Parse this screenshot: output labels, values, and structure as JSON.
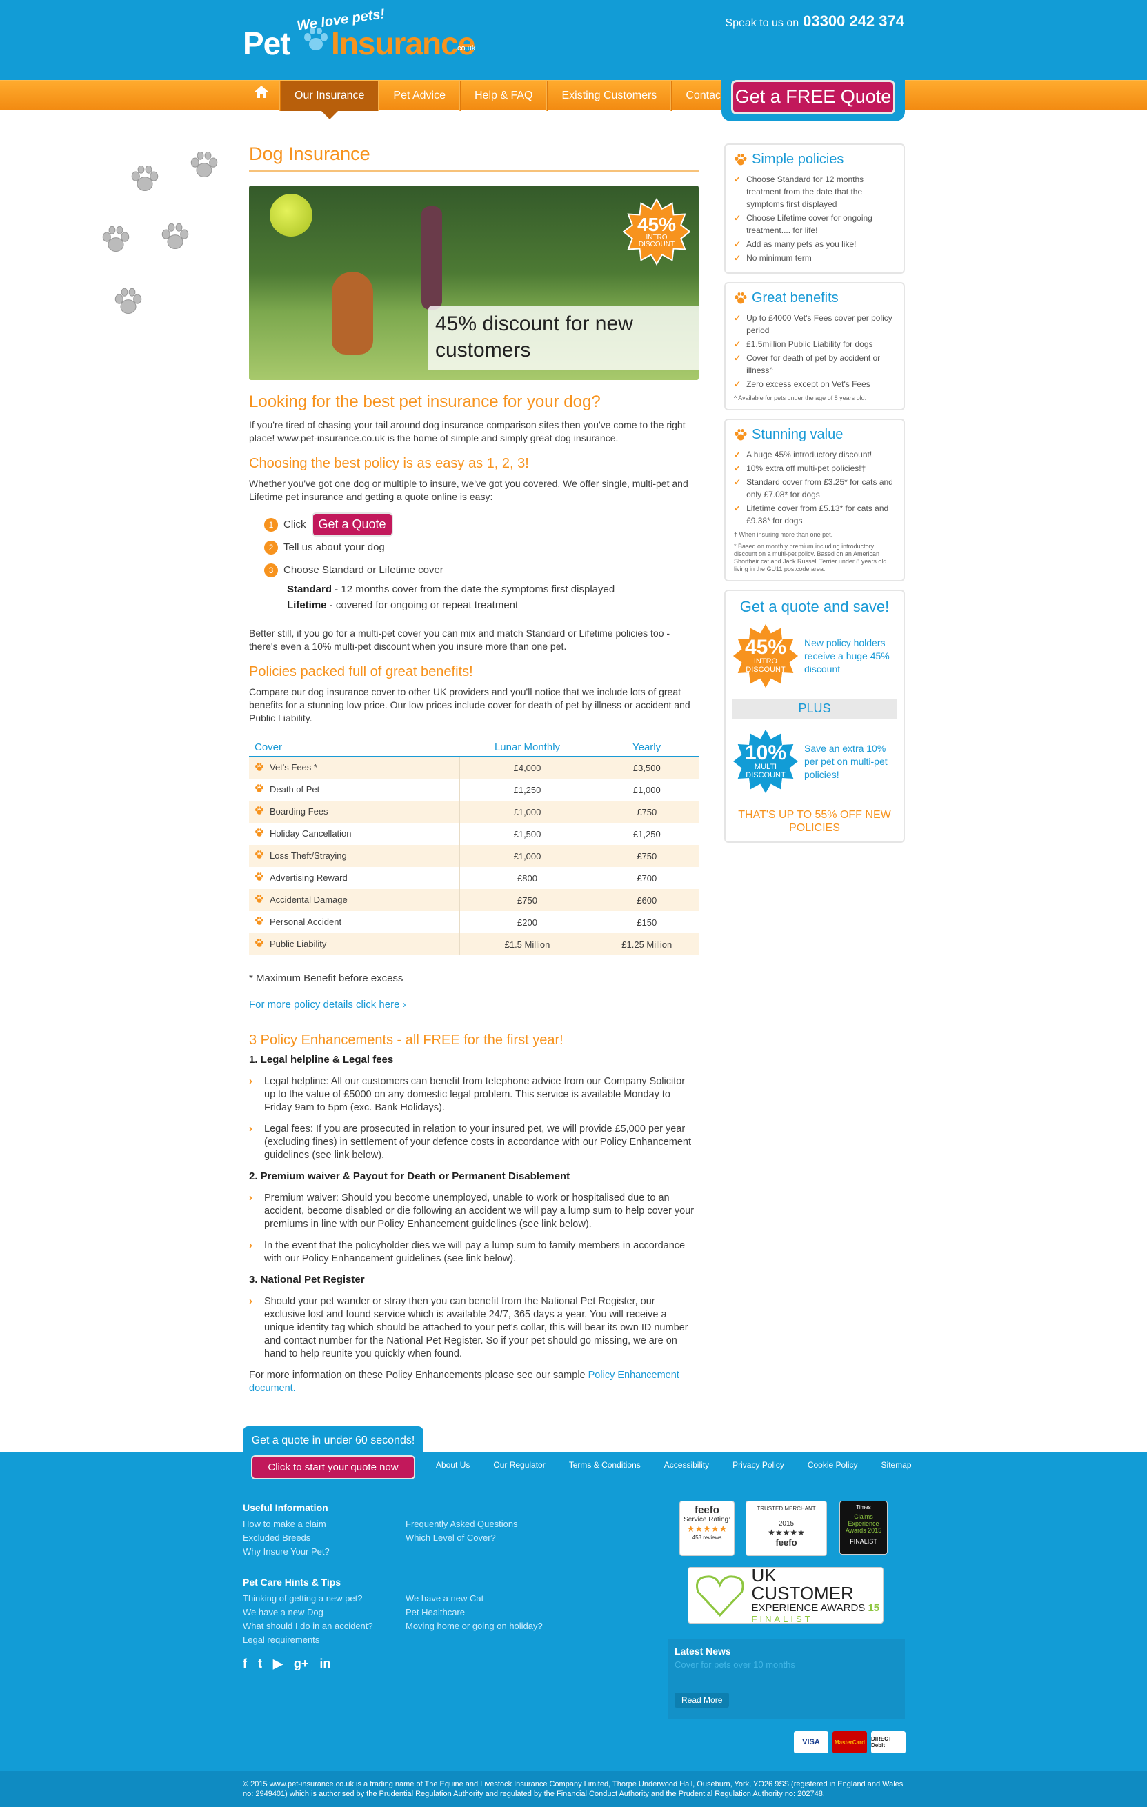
{
  "header": {
    "logo": {
      "tagline": "We love pets!",
      "word1": "Pet",
      "word2": "Insurance",
      "domain": ".co.uk"
    },
    "phone_label": "Speak to us on",
    "phone_number": "03300 242 374",
    "quote_button": "Get a FREE Quote"
  },
  "nav": {
    "items": [
      {
        "label": "Our Insurance",
        "active": true
      },
      {
        "label": "Pet Advice"
      },
      {
        "label": "Help & FAQ"
      },
      {
        "label": "Existing Customers"
      },
      {
        "label": "Contact"
      }
    ]
  },
  "main": {
    "title": "Dog Insurance",
    "hero": {
      "caption": "45% discount for new customers",
      "badge": {
        "pct": "45%",
        "line1": "INTRO",
        "line2": "DISCOUNT"
      }
    },
    "intro_heading": "Looking for the best pet insurance for your dog?",
    "intro_text": "If you're tired of chasing your tail around dog insurance comparison sites then you've come to the right place! www.pet-insurance.co.uk is the home of simple and simply great dog insurance.",
    "easy_heading": "Choosing the best policy is as easy as 1, 2, 3!",
    "easy_text": "Whether you've got one dog or multiple to insure, we've got you covered. We offer single, multi-pet and Lifetime pet insurance and getting a quote online is easy:",
    "steps": [
      {
        "num": "1",
        "text": "Click",
        "button": "Get a Quote"
      },
      {
        "num": "2",
        "text": "Tell us about your dog"
      },
      {
        "num": "3",
        "text": "Choose Standard or Lifetime cover"
      }
    ],
    "standard": {
      "label": "Standard",
      "text": " - 12 months cover from the date the symptoms first displayed"
    },
    "lifetime": {
      "label": "Lifetime",
      "text": " - covered for ongoing or repeat treatment"
    },
    "better_text": "Better still, if you go for a multi-pet cover you can mix and match Standard or Lifetime policies too - there's even a 10% multi-pet discount when you insure more than one pet.",
    "benefits_heading": "Policies packed full of great benefits!",
    "benefits_text": "Compare our dog insurance cover to other UK providers and you'll notice that we include lots of great benefits for a stunning low price. Our low prices include cover for death of pet by illness or accident and Public Liability.",
    "table": {
      "headers": [
        "Cover",
        "Lunar Monthly",
        "Yearly"
      ],
      "rows": [
        [
          "Vet's Fees *",
          "£4,000",
          "£3,500"
        ],
        [
          "Death of Pet",
          "£1,250",
          "£1,000"
        ],
        [
          "Boarding Fees",
          "£1,000",
          "£750"
        ],
        [
          "Holiday Cancellation",
          "£1,500",
          "£1,250"
        ],
        [
          "Loss Theft/Straying",
          "£1,000",
          "£750"
        ],
        [
          "Advertising Reward",
          "£800",
          "£700"
        ],
        [
          "Accidental Damage",
          "£750",
          "£600"
        ],
        [
          "Personal Accident",
          "£200",
          "£150"
        ],
        [
          "Public Liability",
          "£1.5 Million",
          "£1.25 Million"
        ]
      ]
    },
    "max_note": "* Maximum Benefit before excess",
    "more_link": "For more policy details click here ›",
    "enh_heading": "3 Policy Enhancements - all FREE for the first year!",
    "enh": [
      {
        "title": "1. Legal helpline & Legal fees",
        "items": [
          "Legal helpline: All our customers can benefit from telephone advice from our Company Solicitor up to the value of £5000 on any domestic legal problem. This service is available Monday to Friday 9am to 5pm (exc. Bank Holidays).",
          "Legal fees: If you are prosecuted in relation to your insured pet, we will provide £5,000 per year (excluding fines) in settlement of your defence costs in accordance with our Policy Enhancement guidelines (see link below)."
        ]
      },
      {
        "title": "2. Premium waiver & Payout for Death or Permanent Disablement",
        "items": [
          "Premium waiver: Should you become unemployed, unable to work or hospitalised due to an accident, become disabled or die following an accident we will pay a lump sum to help cover your premiums in line with our Policy Enhancement guidelines (see link below).",
          "In the event that the policyholder dies we will pay a lump sum to family members in accordance with our Policy Enhancement guidelines (see link below)."
        ]
      },
      {
        "title": "3. National Pet Register",
        "items": [
          "Should your pet wander or stray then you can benefit from the National Pet Register, our exclusive lost and found service which is available 24/7, 365 days a year. You will receive a unique identity tag which should be attached to your pet's collar, this will bear its own ID number and contact number for the National Pet Register. So if your pet should go missing, we are on hand to help reunite you quickly when found."
        ]
      }
    ],
    "final_text": "For more information on these Policy Enhancements please see our sample ",
    "final_link": "Policy Enhancement document."
  },
  "sidebar": {
    "simple": {
      "title": "Simple policies",
      "items": [
        "Choose Standard for 12 months treatment from the date that the symptoms first displayed",
        "Choose Lifetime cover for ongoing treatment.... for life!",
        "Add as many pets as you like!",
        "No minimum term"
      ]
    },
    "benefits": {
      "title": "Great benefits",
      "items": [
        "Up to £4000 Vet's Fees cover per policy period",
        "£1.5million Public Liability for dogs",
        "Cover for death of pet by accident or illness^",
        "Zero excess except on Vet's Fees"
      ],
      "note": "^ Available for pets under the age of 8 years old."
    },
    "value": {
      "title": "Stunning value",
      "items": [
        "A huge 45% introductory discount!",
        "10% extra off multi-pet policies!†",
        "Standard cover from £3.25* for cats and only £7.08* for dogs",
        "Lifetime cover from £5.13* for cats and £9.38* for dogs"
      ],
      "note1": "† When insuring more than one pet.",
      "note2": "* Based on monthly premium including introductory discount on a multi-pet policy. Based on an American Shorthair cat and Jack Russell Terrier under 8 years old living in the GU11 postcode area."
    },
    "save": {
      "title": "Get a quote and save!",
      "badge1": {
        "pct": "45%",
        "line1": "INTRO",
        "line2": "DISCOUNT"
      },
      "text1": "New policy holders receive a huge 45% discount",
      "plus": "PLUS",
      "badge2": {
        "pct": "10%",
        "line1": "MULTI",
        "line2": "DISCOUNT"
      },
      "text2": "Save an extra 10% per pet on multi-pet policies!",
      "upto": "THAT'S UP TO 55% OFF NEW POLICIES"
    }
  },
  "footer": {
    "quote_title": "Get a quote in under 60 seconds!",
    "quote_button": "Click to start your quote now",
    "links": [
      "About Us",
      "Our Regulator",
      "Terms & Conditions",
      "Accessibility",
      "Privacy Policy",
      "Cookie Policy",
      "Sitemap"
    ],
    "useful": {
      "title": "Useful Information",
      "col1": [
        "How to make a claim",
        "Excluded Breeds",
        "Why Insure Your Pet?"
      ],
      "col2": [
        "Frequently Asked Questions",
        "Which Level of Cover?"
      ]
    },
    "hints": {
      "title": "Pet Care Hints & Tips",
      "col1": [
        "Thinking of getting a new pet?",
        "We have a new Dog",
        "What should I do in an accident?",
        "Legal requirements"
      ],
      "col2": [
        "We have a new Cat",
        "Pet Healthcare",
        "Moving home or going on holiday?"
      ]
    },
    "social": [
      "f",
      "t",
      "▶",
      "g+",
      "in"
    ],
    "awards": {
      "feefo": {
        "brand": "feefo",
        "label": "Service Rating:",
        "stars": "★★★★★",
        "reviews": "453 reviews"
      },
      "trusted": {
        "label": "TRUSTED MERCHANT",
        "year": "2015",
        "stars": "★★★★★",
        "brand": "feefo"
      },
      "claims": {
        "brand": "Times",
        "title": "Claims Experience Awards 2015",
        "finalist": "FINALIST"
      },
      "ukcx": {
        "line1": "UK CUSTOMER",
        "line2": "EXPERIENCE AWARDS",
        "year": "15",
        "finalist": "FINALIST"
      }
    },
    "news": {
      "title": "Latest News",
      "text": "Cover for pets over 10 months",
      "button": "Read More"
    },
    "cards": [
      "VISA",
      "MasterCard",
      "DIRECT Debit"
    ],
    "copyright": "© 2015 www.pet-insurance.co.uk is a trading name of The Equine and Livestock Insurance Company Limited, Thorpe Underwood Hall, Ouseburn, York, YO26 9SS (registered in England and Wales no: 2949401) which is authorised by the Prudential Regulation Authority and regulated by the Financial Conduct Authority and the Prudential Regulation Authority no: 202748."
  },
  "colors": {
    "brand_blue": "#129cd6",
    "orange": "#f7931e",
    "cta_pink": "#c2185b"
  }
}
